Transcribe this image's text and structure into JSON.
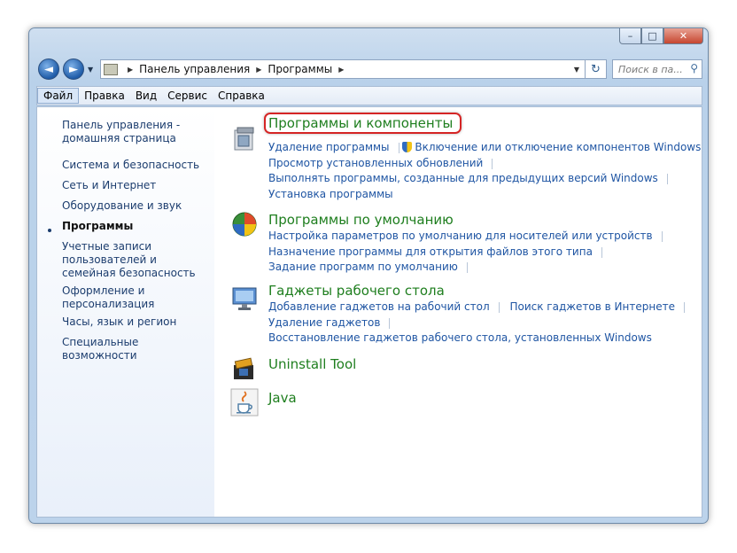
{
  "window": {
    "caption_buttons": {
      "minimize": "–",
      "maximize": "□",
      "close": "✕"
    }
  },
  "navigation": {
    "back_icon": "arrow-left-icon",
    "forward_icon": "arrow-right-icon",
    "breadcrumb": [
      "Панель управления",
      "Программы"
    ],
    "search_placeholder": "Поиск в па..."
  },
  "menu": [
    "Файл",
    "Правка",
    "Вид",
    "Сервис",
    "Справка"
  ],
  "sidebar": [
    "Панель управления - домашняя страница",
    "Система и безопасность",
    "Сеть и Интернет",
    "Оборудование и звук",
    "Программы",
    "Учетные записи пользователей и семейная безопасность",
    "Оформление и персонализация",
    "Часы, язык и регион",
    "Специальные возможности"
  ],
  "sidebar_current": "Программы",
  "sections": [
    {
      "title": "Программы и компоненты",
      "icon": "programs-features-icon",
      "links": [
        "Удаление программы",
        "Включение или отключение компонентов Windows",
        "Просмотр установленных обновлений",
        "Выполнять программы, созданные для предыдущих версий Windows",
        "Установка программы"
      ]
    },
    {
      "title": "Программы по умолчанию",
      "icon": "default-programs-icon",
      "links": [
        "Настройка параметров по умолчанию для носителей или устройств",
        "Назначение программы для открытия файлов этого типа",
        "Задание программ по умолчанию"
      ]
    },
    {
      "title": "Гаджеты рабочего стола",
      "icon": "desktop-gadgets-icon",
      "links": [
        "Добавление гаджетов на рабочий стол",
        "Поиск гаджетов в Интернете",
        "Удаление гаджетов",
        "Восстановление гаджетов рабочего стола, установленных Windows"
      ]
    },
    {
      "title": "Uninstall Tool",
      "icon": "uninstall-tool-icon",
      "links": []
    },
    {
      "title": "Java",
      "icon": "java-icon",
      "links": []
    }
  ],
  "highlight_color": "#d52525"
}
